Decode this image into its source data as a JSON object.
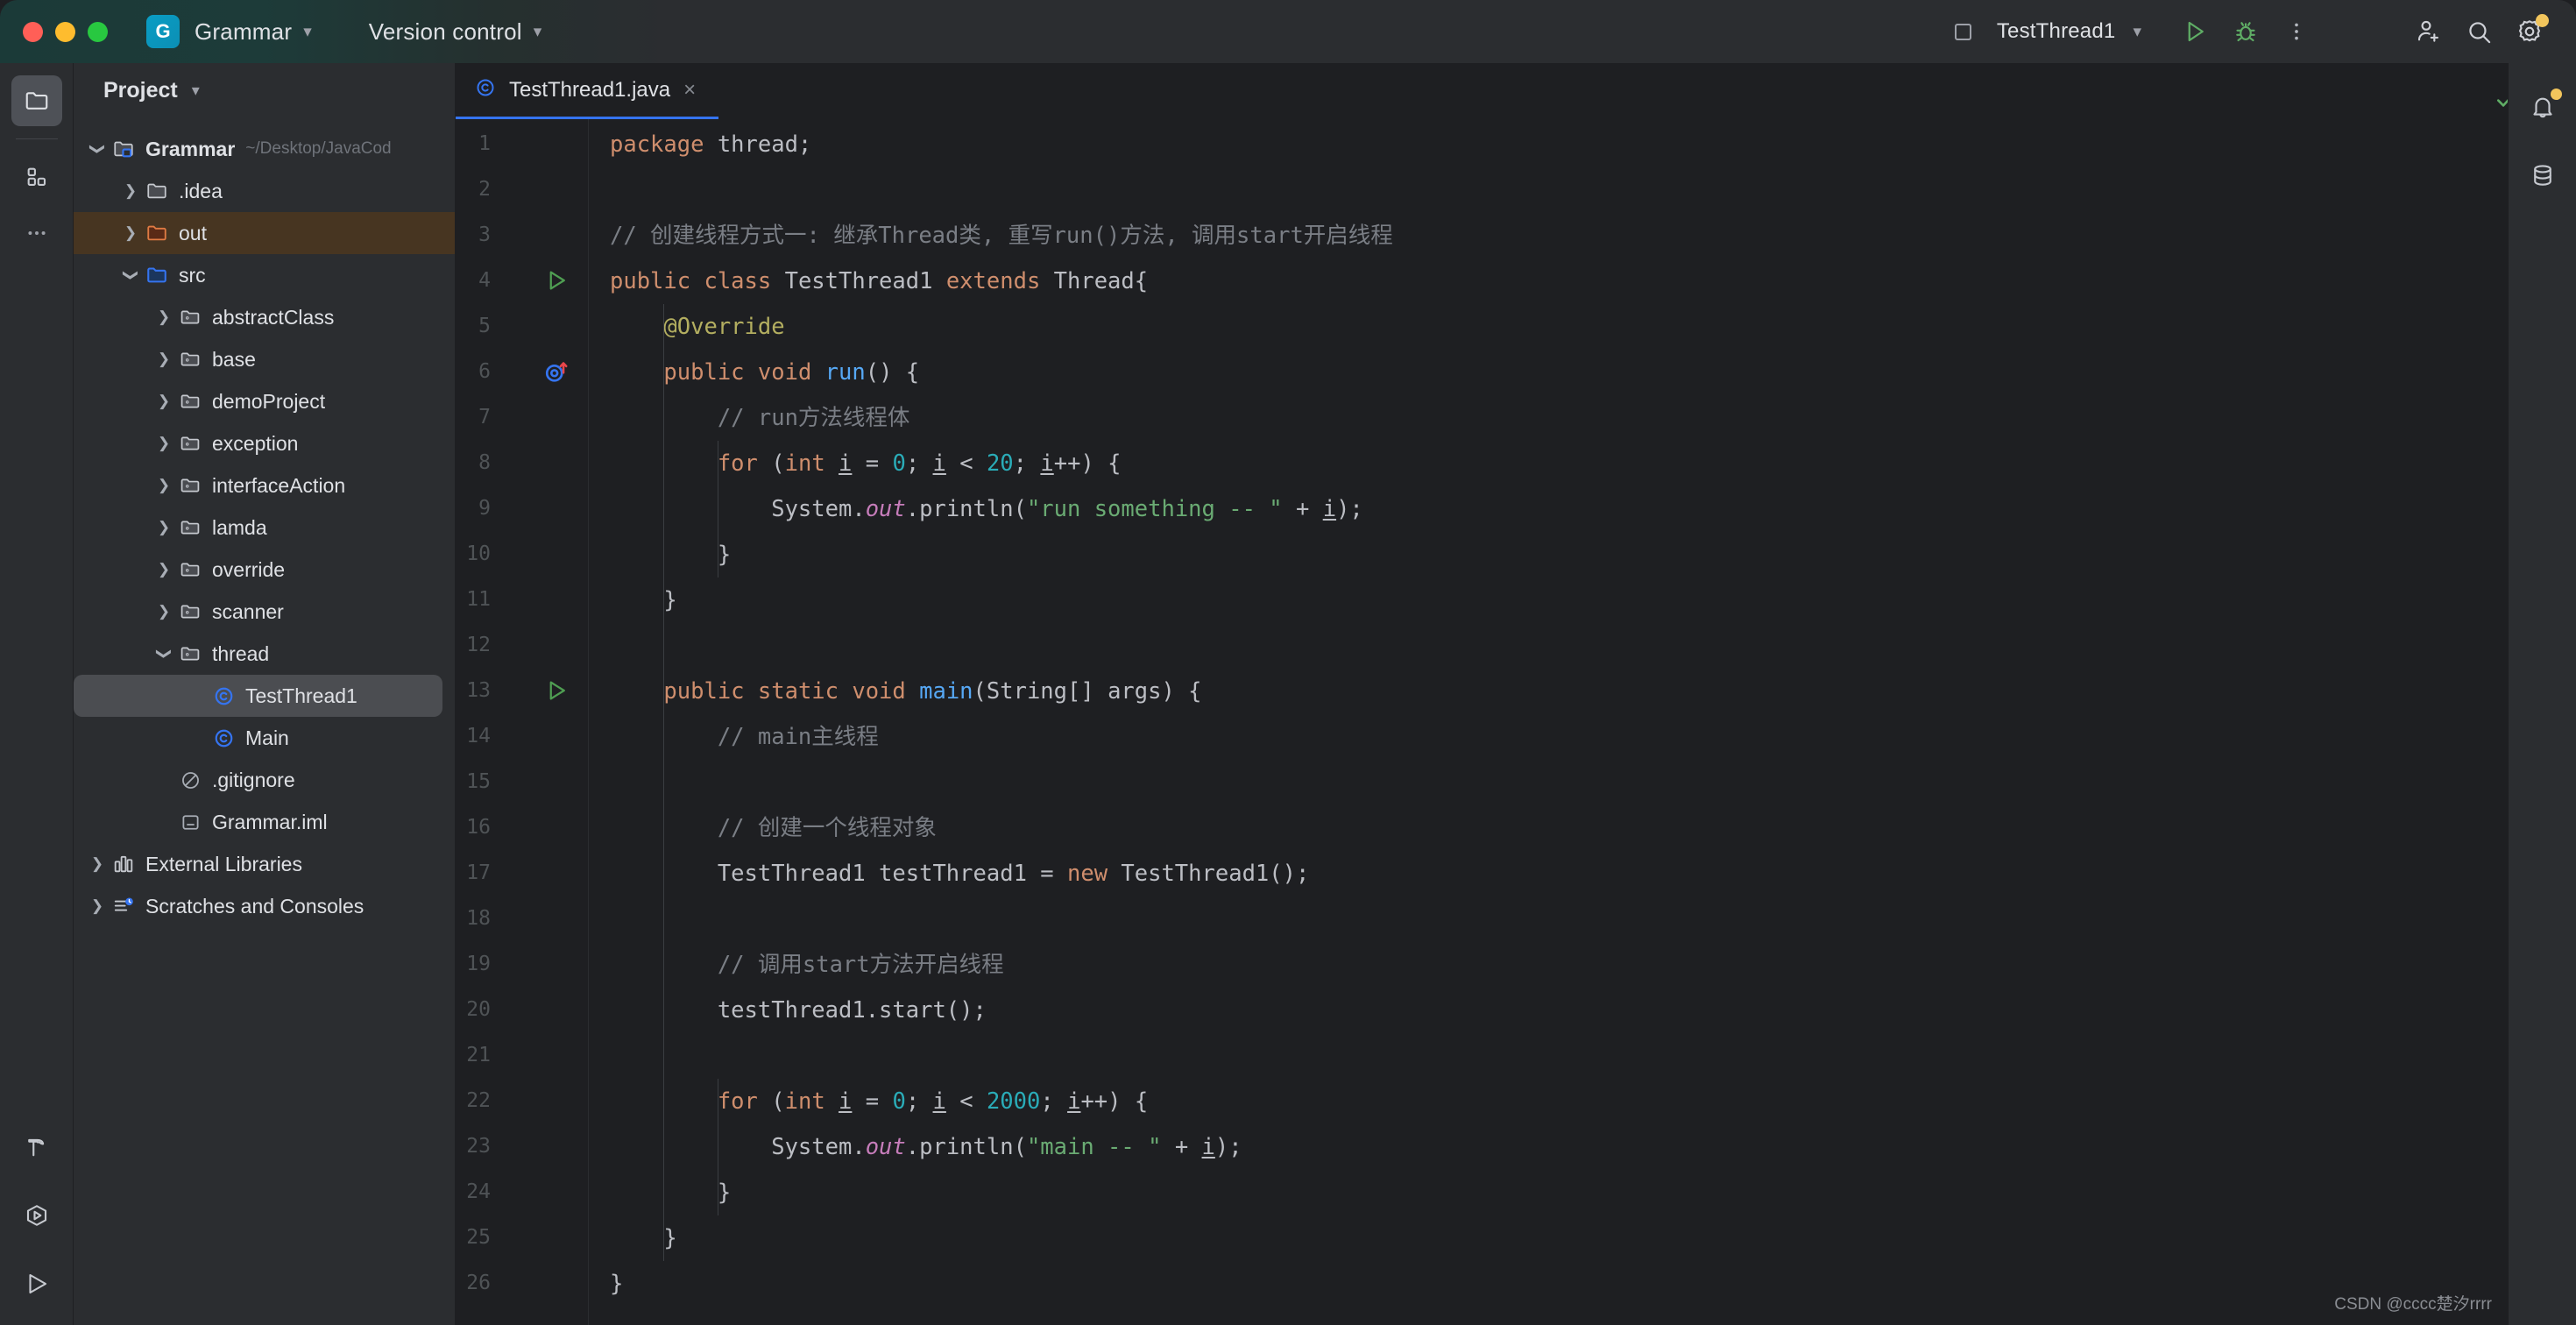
{
  "titlebar": {
    "window_controls": [
      "close",
      "minimize",
      "maximize"
    ],
    "project_badge": "G",
    "project_name": "Grammar",
    "vcs_label": "Version control",
    "run_config": "TestThread1",
    "icons": [
      "run-icon",
      "debug-icon",
      "more-actions-icon",
      "add-user-icon",
      "search-icon",
      "settings-icon"
    ]
  },
  "left_rail": {
    "top": [
      {
        "name": "project-tool-window",
        "icon": "folder-icon",
        "active": true
      },
      {
        "name": "commit-tool-window",
        "icon": "squares-icon",
        "active": false
      },
      {
        "name": "more-tool-windows",
        "icon": "ellipsis-icon",
        "active": false
      }
    ],
    "bottom": [
      {
        "name": "build-tool-window",
        "icon": "hammer-icon"
      },
      {
        "name": "services-tool-window",
        "icon": "services-icon"
      },
      {
        "name": "run-tool-window",
        "icon": "play-icon"
      }
    ]
  },
  "panel": {
    "title": "Project",
    "tree": [
      {
        "indent": 0,
        "arrow": "down",
        "icon": "module-folder-icon",
        "label": "Grammar",
        "sub": "~/Desktop/JavaCod",
        "bold": true,
        "selected": "none"
      },
      {
        "indent": 1,
        "arrow": "right",
        "icon": "folder-icon",
        "label": ".idea",
        "sub": "",
        "bold": false,
        "selected": "none"
      },
      {
        "indent": 1,
        "arrow": "right",
        "icon": "excluded-folder-icon",
        "label": "out",
        "sub": "",
        "bold": false,
        "selected": "brown"
      },
      {
        "indent": 1,
        "arrow": "down",
        "icon": "source-folder-icon",
        "label": "src",
        "sub": "",
        "bold": false,
        "selected": "none"
      },
      {
        "indent": 2,
        "arrow": "right",
        "icon": "package-icon",
        "label": "abstractClass",
        "sub": "",
        "bold": false,
        "selected": "none"
      },
      {
        "indent": 2,
        "arrow": "right",
        "icon": "package-icon",
        "label": "base",
        "sub": "",
        "bold": false,
        "selected": "none"
      },
      {
        "indent": 2,
        "arrow": "right",
        "icon": "package-icon",
        "label": "demoProject",
        "sub": "",
        "bold": false,
        "selected": "none"
      },
      {
        "indent": 2,
        "arrow": "right",
        "icon": "package-icon",
        "label": "exception",
        "sub": "",
        "bold": false,
        "selected": "none"
      },
      {
        "indent": 2,
        "arrow": "right",
        "icon": "package-icon",
        "label": "interfaceAction",
        "sub": "",
        "bold": false,
        "selected": "none"
      },
      {
        "indent": 2,
        "arrow": "right",
        "icon": "package-icon",
        "label": "lamda",
        "sub": "",
        "bold": false,
        "selected": "none"
      },
      {
        "indent": 2,
        "arrow": "right",
        "icon": "package-icon",
        "label": "override",
        "sub": "",
        "bold": false,
        "selected": "none"
      },
      {
        "indent": 2,
        "arrow": "right",
        "icon": "package-icon",
        "label": "scanner",
        "sub": "",
        "bold": false,
        "selected": "none"
      },
      {
        "indent": 2,
        "arrow": "down",
        "icon": "package-icon",
        "label": "thread",
        "sub": "",
        "bold": false,
        "selected": "none"
      },
      {
        "indent": 3,
        "arrow": "none",
        "icon": "java-class-icon",
        "label": "TestThread1",
        "sub": "",
        "bold": false,
        "selected": "gray"
      },
      {
        "indent": 3,
        "arrow": "none",
        "icon": "java-class-icon",
        "label": "Main",
        "sub": "",
        "bold": false,
        "selected": "none"
      },
      {
        "indent": 2,
        "arrow": "none",
        "icon": "gitignore-icon",
        "label": ".gitignore",
        "sub": "",
        "bold": false,
        "selected": "none"
      },
      {
        "indent": 2,
        "arrow": "none",
        "icon": "iml-icon",
        "label": "Grammar.iml",
        "sub": "",
        "bold": false,
        "selected": "none"
      },
      {
        "indent": 0,
        "arrow": "right",
        "icon": "libraries-icon",
        "label": "External Libraries",
        "sub": "",
        "bold": false,
        "selected": "none"
      },
      {
        "indent": 0,
        "arrow": "right",
        "icon": "scratches-icon",
        "label": "Scratches and Consoles",
        "sub": "",
        "bold": false,
        "selected": "none"
      }
    ]
  },
  "editor": {
    "tab": {
      "label": "TestThread1.java",
      "icon": "java-class-icon",
      "close": "×"
    },
    "options_icon": "more-vertical-icon",
    "inspection_status": "ok-check-icon",
    "line_count": 26,
    "gutter_marks": [
      {
        "line": 4,
        "icon": "run-class-gutter-icon"
      },
      {
        "line": 6,
        "icon": "overriding-method-gutter-icon"
      },
      {
        "line": 13,
        "icon": "run-method-gutter-icon"
      }
    ],
    "lines": [
      {
        "n": 1,
        "tokens": [
          {
            "t": "package",
            "c": "k"
          },
          {
            "t": " thread;",
            "c": ""
          }
        ]
      },
      {
        "n": 2,
        "tokens": []
      },
      {
        "n": 3,
        "tokens": [
          {
            "t": "// 创建线程方式一: 继承Thread类, 重写run()方法, 调用start开启线程",
            "c": "c"
          }
        ]
      },
      {
        "n": 4,
        "tokens": [
          {
            "t": "public class",
            "c": "k"
          },
          {
            "t": " TestThread1 ",
            "c": ""
          },
          {
            "t": "extends",
            "c": "k"
          },
          {
            "t": " Thread{",
            "c": ""
          }
        ]
      },
      {
        "n": 5,
        "tokens": [
          {
            "t": "    @Override",
            "c": "a"
          }
        ]
      },
      {
        "n": 6,
        "tokens": [
          {
            "t": "    ",
            "c": ""
          },
          {
            "t": "public void",
            "c": "k"
          },
          {
            "t": " ",
            "c": ""
          },
          {
            "t": "run",
            "c": "m"
          },
          {
            "t": "() {",
            "c": ""
          }
        ]
      },
      {
        "n": 7,
        "tokens": [
          {
            "t": "        // run方法线程体",
            "c": "c"
          }
        ]
      },
      {
        "n": 8,
        "tokens": [
          {
            "t": "        ",
            "c": ""
          },
          {
            "t": "for",
            "c": "k"
          },
          {
            "t": " (",
            "c": ""
          },
          {
            "t": "int",
            "c": "k"
          },
          {
            "t": " ",
            "c": ""
          },
          {
            "t": "i",
            "c": "u"
          },
          {
            "t": " = ",
            "c": ""
          },
          {
            "t": "0",
            "c": "n"
          },
          {
            "t": "; ",
            "c": ""
          },
          {
            "t": "i",
            "c": "u"
          },
          {
            "t": " < ",
            "c": ""
          },
          {
            "t": "20",
            "c": "n"
          },
          {
            "t": "; ",
            "c": ""
          },
          {
            "t": "i",
            "c": "u"
          },
          {
            "t": "++) {",
            "c": ""
          }
        ]
      },
      {
        "n": 9,
        "tokens": [
          {
            "t": "            System.",
            "c": ""
          },
          {
            "t": "out",
            "c": "f"
          },
          {
            "t": ".println(",
            "c": ""
          },
          {
            "t": "\"run something -- \"",
            "c": "s"
          },
          {
            "t": " + ",
            "c": ""
          },
          {
            "t": "i",
            "c": "u"
          },
          {
            "t": ");",
            "c": ""
          }
        ]
      },
      {
        "n": 10,
        "tokens": [
          {
            "t": "        }",
            "c": ""
          }
        ]
      },
      {
        "n": 11,
        "tokens": [
          {
            "t": "    }",
            "c": ""
          }
        ]
      },
      {
        "n": 12,
        "tokens": []
      },
      {
        "n": 13,
        "tokens": [
          {
            "t": "    ",
            "c": ""
          },
          {
            "t": "public static void",
            "c": "k"
          },
          {
            "t": " ",
            "c": ""
          },
          {
            "t": "main",
            "c": "m"
          },
          {
            "t": "(String[] args) {",
            "c": ""
          }
        ]
      },
      {
        "n": 14,
        "tokens": [
          {
            "t": "        // main主线程",
            "c": "c"
          }
        ]
      },
      {
        "n": 15,
        "tokens": []
      },
      {
        "n": 16,
        "tokens": [
          {
            "t": "        // 创建一个线程对象",
            "c": "c"
          }
        ]
      },
      {
        "n": 17,
        "tokens": [
          {
            "t": "        TestThread1 testThread1 = ",
            "c": ""
          },
          {
            "t": "new",
            "c": "k"
          },
          {
            "t": " TestThread1();",
            "c": ""
          }
        ]
      },
      {
        "n": 18,
        "tokens": []
      },
      {
        "n": 19,
        "tokens": [
          {
            "t": "        // 调用start方法开启线程",
            "c": "c"
          }
        ]
      },
      {
        "n": 20,
        "tokens": [
          {
            "t": "        testThread1.start();",
            "c": ""
          }
        ]
      },
      {
        "n": 21,
        "tokens": []
      },
      {
        "n": 22,
        "tokens": [
          {
            "t": "        ",
            "c": ""
          },
          {
            "t": "for",
            "c": "k"
          },
          {
            "t": " (",
            "c": ""
          },
          {
            "t": "int",
            "c": "k"
          },
          {
            "t": " ",
            "c": ""
          },
          {
            "t": "i",
            "c": "u"
          },
          {
            "t": " = ",
            "c": ""
          },
          {
            "t": "0",
            "c": "n"
          },
          {
            "t": "; ",
            "c": ""
          },
          {
            "t": "i",
            "c": "u"
          },
          {
            "t": " < ",
            "c": ""
          },
          {
            "t": "2000",
            "c": "n"
          },
          {
            "t": "; ",
            "c": ""
          },
          {
            "t": "i",
            "c": "u"
          },
          {
            "t": "++) {",
            "c": ""
          }
        ]
      },
      {
        "n": 23,
        "tokens": [
          {
            "t": "            System.",
            "c": ""
          },
          {
            "t": "out",
            "c": "f"
          },
          {
            "t": ".println(",
            "c": ""
          },
          {
            "t": "\"main -- \"",
            "c": "s"
          },
          {
            "t": " + ",
            "c": ""
          },
          {
            "t": "i",
            "c": "u"
          },
          {
            "t": ");",
            "c": ""
          }
        ]
      },
      {
        "n": 24,
        "tokens": [
          {
            "t": "        }",
            "c": ""
          }
        ]
      },
      {
        "n": 25,
        "tokens": [
          {
            "t": "    }",
            "c": ""
          }
        ]
      },
      {
        "n": 26,
        "tokens": [
          {
            "t": "}",
            "c": ""
          }
        ]
      }
    ]
  },
  "right_rail": {
    "items": [
      {
        "name": "notifications",
        "icon": "bell-icon",
        "badge": true
      },
      {
        "name": "database",
        "icon": "database-icon",
        "badge": false
      }
    ]
  },
  "watermark": "CSDN @cccc楚汐rrrr",
  "colors": {
    "bg_editor": "#1E1F22",
    "bg_panel": "#2B2D30",
    "accent_blue": "#3574F0",
    "keyword": "#CF8E6D",
    "string": "#6AAB73",
    "number": "#2AACB8",
    "comment": "#7A7E85",
    "method": "#56A8F5",
    "annotation": "#B3AE60",
    "static_field": "#C77DBB",
    "default_text": "#BCBEC4",
    "title_tint": "#1B3A38"
  }
}
